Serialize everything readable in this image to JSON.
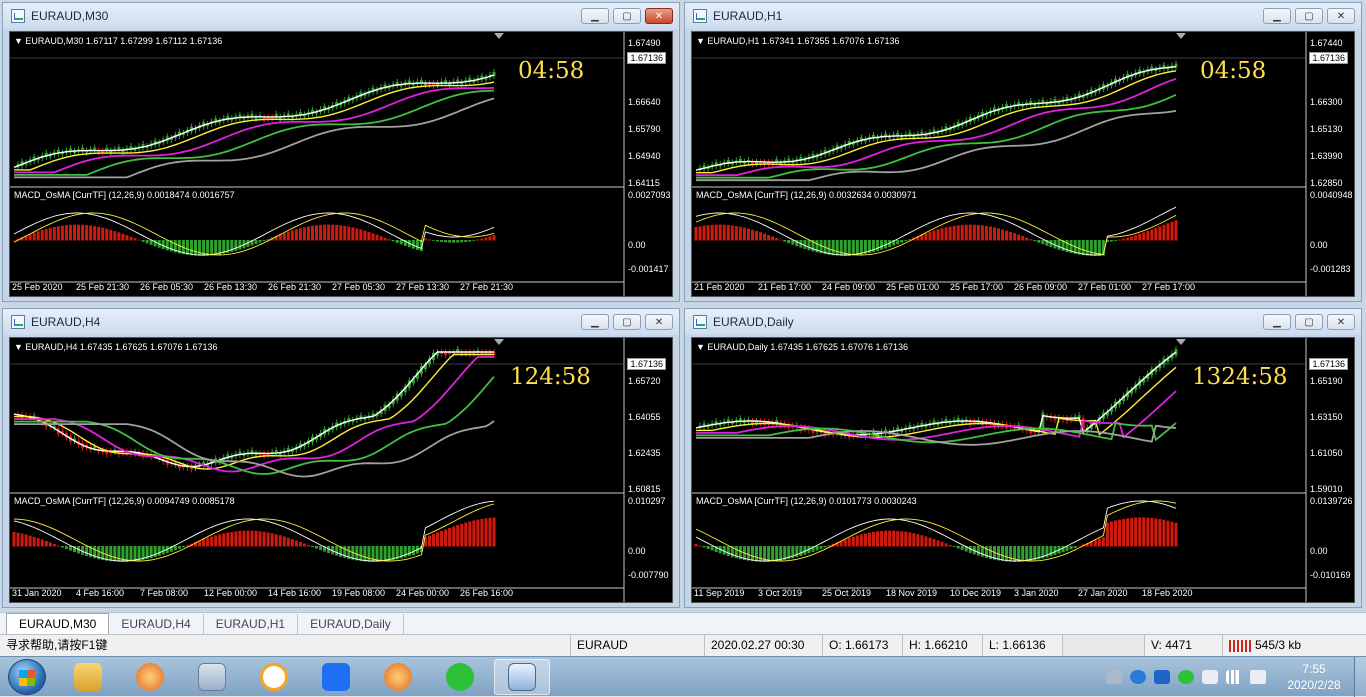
{
  "windows": [
    {
      "id": "m30",
      "title": "EURAUD,M30",
      "header": "EURAUD,M30  1.67117 1.67299 1.67112 1.67136",
      "timer": "04:58",
      "current_price": "1.67136",
      "price_axis": [
        "1.67490",
        "1.66640",
        "1.65790",
        "1.64940",
        "1.64115"
      ],
      "macd_label": "MACD_OsMA [CurrTF] (12,26,9) 0.0018474 0.0016757",
      "macd_axis": [
        "0.0027093",
        "0.00",
        "-0.001417"
      ],
      "time_axis": [
        "25 Feb 2020",
        "25 Feb 21:30",
        "26 Feb 05:30",
        "26 Feb 13:30",
        "26 Feb 21:30",
        "27 Feb 05:30",
        "27 Feb 13:30",
        "27 Feb 21:30"
      ],
      "close_active": true
    },
    {
      "id": "h1",
      "title": "EURAUD,H1",
      "header": "EURAUD,H1  1.67341 1.67355 1.67076 1.67136",
      "timer": "04:58",
      "current_price": "1.67136",
      "price_axis": [
        "1.67440",
        "1.66300",
        "1.65130",
        "1.63990",
        "1.62850"
      ],
      "macd_label": "MACD_OsMA [CurrTF] (12,26,9) 0.0032634 0.0030971",
      "macd_axis": [
        "0.0040948",
        "0.00",
        "-0.001283"
      ],
      "time_axis": [
        "21 Feb 2020",
        "21 Feb 17:00",
        "24 Feb 09:00",
        "25 Feb 01:00",
        "25 Feb 17:00",
        "26 Feb 09:00",
        "27 Feb 01:00",
        "27 Feb 17:00"
      ],
      "close_active": false
    },
    {
      "id": "h4",
      "title": "EURAUD,H4",
      "header": "EURAUD,H4  1.67435 1.67625 1.67076 1.67136",
      "timer": "124:58",
      "current_price": "1.67136",
      "price_axis": [
        "1.65720",
        "1.64055",
        "1.62435",
        "1.60815"
      ],
      "macd_label": "MACD_OsMA [CurrTF] (12,26,9) 0.0094749 0.0085178",
      "macd_axis": [
        "0.010297",
        "0.00",
        "-0.007790"
      ],
      "time_axis": [
        "31 Jan 2020",
        "4 Feb 16:00",
        "7 Feb 08:00",
        "12 Feb 00:00",
        "14 Feb 16:00",
        "19 Feb 08:00",
        "24 Feb 00:00",
        "26 Feb 16:00"
      ],
      "close_active": false
    },
    {
      "id": "daily",
      "title": "EURAUD,Daily",
      "header": "EURAUD,Daily  1.67435 1.67625 1.67076 1.67136",
      "timer": "1324:58",
      "current_price": "1.67136",
      "price_axis": [
        "1.65190",
        "1.63150",
        "1.61050",
        "1.59010"
      ],
      "macd_label": "MACD_OsMA [CurrTF] (12,26,9) 0.0101773 0.0030243",
      "macd_axis": [
        "0.0139726",
        "0.00",
        "-0.010169"
      ],
      "time_axis": [
        "11 Sep 2019",
        "3 Oct 2019",
        "25 Oct 2019",
        "18 Nov 2019",
        "10 Dec 2019",
        "3 Jan 2020",
        "27 Jan 2020",
        "18 Feb 2020"
      ],
      "close_active": false
    }
  ],
  "tabs": [
    "EURAUD,M30",
    "EURAUD,H4",
    "EURAUD,H1",
    "EURAUD,Daily"
  ],
  "active_tab": 0,
  "status": {
    "help": "寻求帮助,请按F1键",
    "symbol": "EURAUD",
    "datetime": "2020.02.27 00:30",
    "open": "O: 1.66173",
    "high": "H: 1.66210",
    "low": "L: 1.66136",
    "volume": "V: 4471",
    "traffic": "545/3 kb"
  },
  "clock": {
    "time": "7:55",
    "date": "2020/2/28"
  },
  "colors": {
    "bull": "#2ea12e",
    "bear": "#d01a10",
    "ma_fast": "#ffffff",
    "ma_yellow": "#ffee33",
    "ma_magenta": "#e020e0",
    "ma_green": "#40c040",
    "ma_gray": "#a0a0a0",
    "timer": "#ffe04a"
  }
}
